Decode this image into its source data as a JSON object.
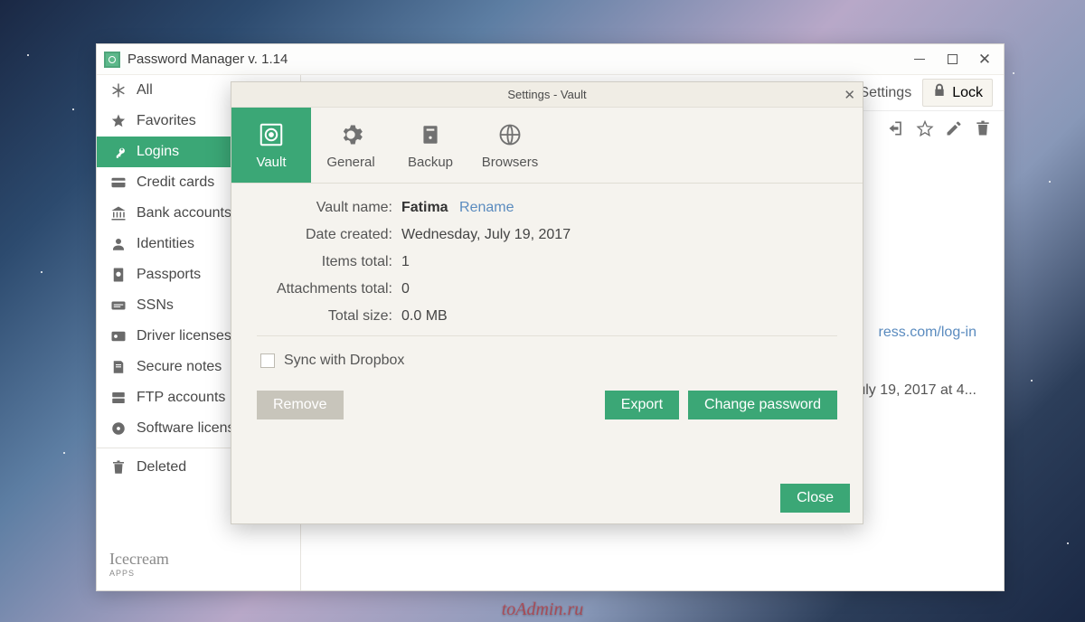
{
  "window": {
    "title": "Password Manager v. 1.14"
  },
  "toolbar": {
    "settings": "Settings",
    "lock": "Lock"
  },
  "sidebar": {
    "items": [
      {
        "label": "All"
      },
      {
        "label": "Favorites"
      },
      {
        "label": "Logins"
      },
      {
        "label": "Credit cards"
      },
      {
        "label": "Bank accounts"
      },
      {
        "label": "Identities"
      },
      {
        "label": "Passports"
      },
      {
        "label": "SSNs"
      },
      {
        "label": "Driver licenses"
      },
      {
        "label": "Secure notes"
      },
      {
        "label": "FTP accounts"
      },
      {
        "label": "Software licenses"
      }
    ],
    "deleted": "Deleted",
    "brand": "Icecream",
    "brand_sub": "APPS"
  },
  "detail": {
    "url_fragment": "ress.com/log-in",
    "date_fragment": "uly 19, 2017 at 4..."
  },
  "modal": {
    "title": "Settings - Vault",
    "tabs": {
      "vault": "Vault",
      "general": "General",
      "backup": "Backup",
      "browsers": "Browsers"
    },
    "fields": {
      "vault_name_label": "Vault name:",
      "vault_name_value": "Fatima",
      "rename": "Rename",
      "date_created_label": "Date created:",
      "date_created_value": "Wednesday, July 19, 2017",
      "items_total_label": "Items total:",
      "items_total_value": "1",
      "attachments_label": "Attachments total:",
      "attachments_value": "0",
      "total_size_label": "Total size:",
      "total_size_value": "0.0 MB"
    },
    "sync_label": "Sync with Dropbox",
    "buttons": {
      "remove": "Remove",
      "export": "Export",
      "change_password": "Change password",
      "close": "Close"
    }
  },
  "watermark": "toAdmin.ru"
}
